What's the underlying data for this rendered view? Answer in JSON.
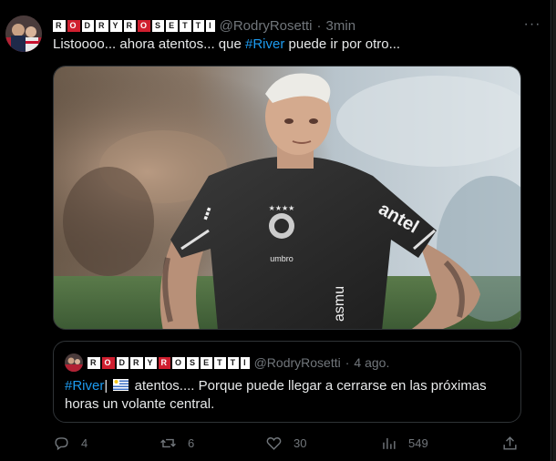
{
  "tweet": {
    "author_display_letters": [
      "R",
      "O",
      "D",
      "R",
      "Y",
      "R",
      "O",
      "S",
      "E",
      "T",
      "T",
      "I"
    ],
    "author_letter_red": [
      false,
      true,
      false,
      false,
      false,
      false,
      true,
      false,
      false,
      false,
      false,
      false
    ],
    "handle": "@RodryRosetti",
    "separator": "·",
    "time": "3min",
    "more": "···",
    "text_before": "Listoooo... ahora atentos... que ",
    "hashtag": "#River",
    "text_after": " puede ir por otro..."
  },
  "media": {
    "jersey_brand": "antel",
    "sleeve_text": "asmu",
    "kit_logo": "umbro",
    "crest_stars": "★★★★"
  },
  "quoted": {
    "author_display_letters": [
      "R",
      "O",
      "D",
      "R",
      "Y",
      "R",
      "O",
      "S",
      "E",
      "T",
      "T",
      "I"
    ],
    "author_letter_red": [
      false,
      true,
      false,
      false,
      false,
      true,
      false,
      false,
      false,
      false,
      false,
      false
    ],
    "handle": "@RodryRosetti",
    "separator": "·",
    "time": "4 ago.",
    "hashtag": "#River",
    "pipe": "|",
    "text": " atentos.... Porque puede llegar a cerrarse en las próximas horas un volante central."
  },
  "actions": {
    "replies": "4",
    "retweets": "6",
    "likes": "30",
    "views": "549"
  },
  "colors": {
    "accent": "#1d9bf0",
    "muted": "#71767b",
    "border": "#2f3336",
    "brand_red": "#d01f2f"
  }
}
